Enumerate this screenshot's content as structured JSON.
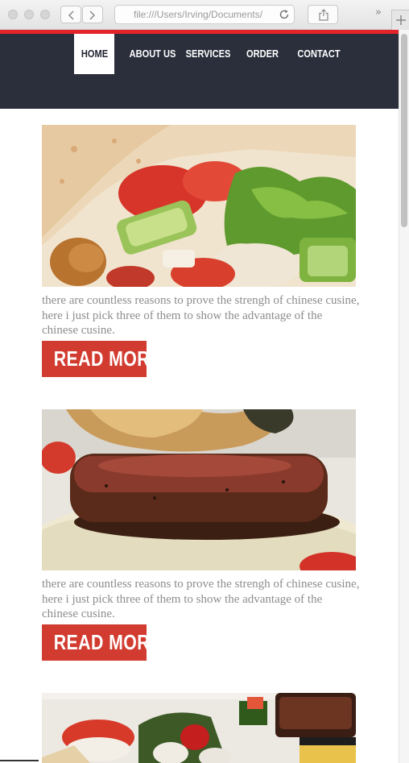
{
  "browser": {
    "url": "file:///Users/Irving/Documents/",
    "overflow_glyph": "»"
  },
  "nav": {
    "items": [
      {
        "label": "HOME",
        "active": true
      },
      {
        "label": "ABOUT US",
        "active": false
      },
      {
        "label": "SERVICES",
        "active": false
      },
      {
        "label": "ORDER",
        "active": false
      },
      {
        "label": "CONTACT",
        "active": false
      }
    ]
  },
  "articles": [
    {
      "image": "burrito-wrap-photo",
      "text": "there are countless reasons to prove the strengh of chinese cusine, here i just pick three of them to show the advantage of the chinese cusine.",
      "button_label": "READ MORE"
    },
    {
      "image": "steak-photo",
      "text": "there are countless reasons to prove the strengh of chinese cusine, here i just pick three of them to show the advantage of the chinese cusine.",
      "button_label": "READ MORE"
    },
    {
      "image": "sushi-platter-photo"
    }
  ],
  "colors": {
    "header_bg": "#2b2f3c",
    "accent_red": "#e3242b",
    "button_red": "#d23b30",
    "body_text": "#8d8d8d"
  }
}
